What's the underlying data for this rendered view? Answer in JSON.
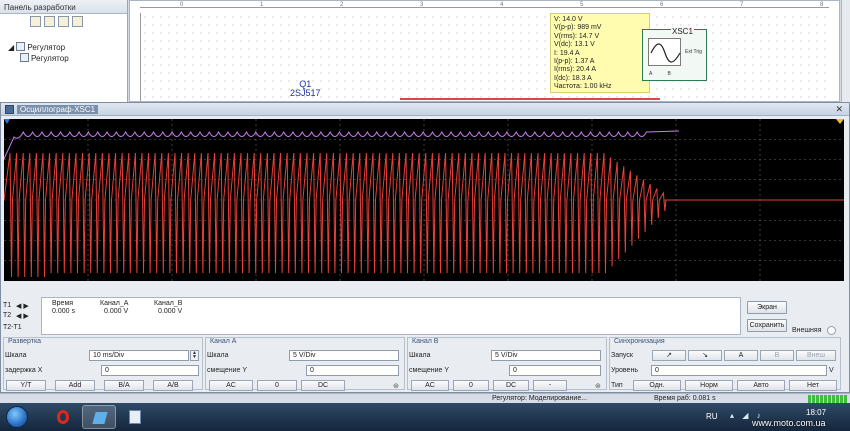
{
  "design_panel": {
    "title": "Панель разработки",
    "tree": [
      {
        "label": "Регулятор"
      },
      {
        "label": "Регулятор"
      }
    ]
  },
  "schematic": {
    "ruler": [
      "0",
      "1",
      "2",
      "3",
      "4",
      "5",
      "6",
      "7",
      "8"
    ],
    "component": {
      "ref": "Q1",
      "part": "2SJ517"
    },
    "probe_readout": [
      "V: 14.0 V",
      "V(p-p): 989 mV",
      "V(rms): 14.7 V",
      "V(dc): 13.1 V",
      "I: 19.4 A",
      "I(p-p): 1.37 A",
      "I(rms): 20.4 A",
      "I(dc): 18.3 A",
      "Частота: 1.00 kHz"
    ],
    "instrument": {
      "label": "XSC1",
      "ext_trig": "Ext Trig",
      "pins": "A B"
    }
  },
  "oscilloscope": {
    "title": "Осциллограф-XSC1",
    "colors": {
      "channel_a": "#e8403a",
      "channel_b": "#c77be8",
      "grid": "#6a6a6a",
      "background": "#000000"
    },
    "cursors": {
      "rows": [
        "T1",
        "T2",
        "T2-T1"
      ],
      "headers": {
        "time": "Время",
        "ch_a": "Канал_A",
        "ch_b": "Канал_B"
      },
      "t1": {
        "time": "0.000 s",
        "ch_a": "0.000 V",
        "ch_b": "0.000 V"
      }
    },
    "buttons": {
      "screen": "Экран",
      "save": "Сохранить",
      "external": "Внешняя"
    },
    "timebase": {
      "title": "Развертка",
      "scale_label": "Шкала",
      "scale_value": "10 ms/Div",
      "xpos_label": "задержка X",
      "xpos_value": "0",
      "modes": [
        "Y/T",
        "Add",
        "B/A",
        "A/B"
      ]
    },
    "channel_a": {
      "title": "Канал A",
      "scale_label": "Шкала",
      "scale_value": "5 V/Div",
      "ypos_label": "смещение Y",
      "ypos_value": "0",
      "coupling": [
        "AC",
        "0",
        "DC"
      ]
    },
    "channel_b": {
      "title": "Канал B",
      "scale_label": "Шкала",
      "scale_value": "5 V/Div",
      "ypos_label": "смещение Y",
      "ypos_value": "0",
      "coupling": [
        "AC",
        "0",
        "DC",
        "-"
      ]
    },
    "trigger": {
      "title": "Синхронизация",
      "edge_label": "Запуск",
      "edges": [
        "↗",
        "↘",
        "A",
        "B",
        "Внеш"
      ],
      "level_label": "Уровень",
      "level_value": "0",
      "level_unit": "V",
      "type_label": "Тип",
      "types": [
        "Одн.",
        "Норм",
        "Авто",
        "Нет"
      ]
    }
  },
  "statusbar": {
    "message": "Регулятор: Моделирование...",
    "sim_time": "Время раб: 0.081 s"
  },
  "taskbar": {
    "language": "RU",
    "clock": "18:07",
    "watermark": "www.moto.com.ua"
  }
}
